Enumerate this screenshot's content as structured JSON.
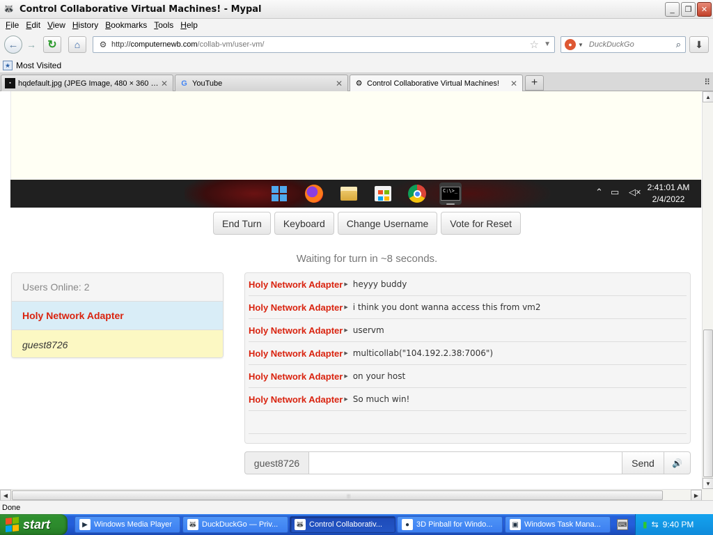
{
  "window": {
    "title": "Control Collaborative Virtual Machines! - Mypal",
    "minimize_glyph": "_",
    "maximize_glyph": "❐",
    "close_glyph": "✕"
  },
  "menu": {
    "items": [
      {
        "underline": "F",
        "rest": "ile"
      },
      {
        "underline": "E",
        "rest": "dit"
      },
      {
        "underline": "V",
        "rest": "iew"
      },
      {
        "underline": "H",
        "rest": "istory"
      },
      {
        "underline": "B",
        "rest": "ookmarks"
      },
      {
        "underline": "T",
        "rest": "ools"
      },
      {
        "underline": "H",
        "rest": "elp"
      }
    ]
  },
  "navbar": {
    "url_scheme": "http://",
    "url_host": "computernewb.com",
    "url_path": "/collab-vm/user-vm/",
    "search_placeholder": "DuckDuckGo"
  },
  "bookmarks": {
    "items": [
      "Most Visited"
    ]
  },
  "tabs": {
    "items": [
      {
        "label": "hqdefault.jpg (JPEG Image, 480 × 360 pi...",
        "icon": "image-thumb-icon",
        "active": false
      },
      {
        "label": "YouTube",
        "icon": "google-icon",
        "active": false
      },
      {
        "label": "Control Collaborative Virtual Machines!",
        "icon": "collabvm-icon",
        "active": true
      }
    ],
    "new_tab": "+"
  },
  "vm": {
    "clock_time": "2:41:01 AM",
    "clock_date": "2/4/2022",
    "taskbar_icons": [
      "windows-start-icon",
      "firefox-icon",
      "file-explorer-icon",
      "microsoft-store-icon",
      "chrome-icon",
      "terminal-icon"
    ],
    "terminal_text": "C:\\>_"
  },
  "controls": {
    "end_turn": "End Turn",
    "keyboard": "Keyboard",
    "change_username": "Change Username",
    "vote_reset": "Vote for Reset"
  },
  "status_message": "Waiting for turn in ~8 seconds.",
  "users": {
    "header": "Users Online: 2",
    "list": [
      {
        "name": "Holy Network Adapter",
        "role": "admin"
      },
      {
        "name": "guest8726",
        "role": "guest"
      }
    ]
  },
  "chat": {
    "messages": [
      {
        "user": "Holy Network Adapter",
        "text": "heyyy buddy"
      },
      {
        "user": "Holy Network Adapter",
        "text": "i think you dont wanna access this from vm2"
      },
      {
        "user": "Holy Network Adapter",
        "text": "uservm"
      },
      {
        "user": "Holy Network Adapter",
        "text": "multicollab(\"104.192.2.38:7006\")"
      },
      {
        "user": "Holy Network Adapter",
        "text": "on your host"
      },
      {
        "user": "Holy Network Adapter",
        "text": "So much win!"
      }
    ],
    "nick": "guest8726",
    "input_value": "",
    "send_label": "Send",
    "volume_glyph": "🔊"
  },
  "statusbar": {
    "text": "Done"
  },
  "xp_taskbar": {
    "start_label": "start",
    "tasks": [
      {
        "label": "Windows Media Player",
        "icon": "media-player-icon",
        "active": false
      },
      {
        "label": "DuckDuckGo — Priv...",
        "icon": "duckduckgo-icon",
        "active": false
      },
      {
        "label": "Control Collaborativ...",
        "icon": "collabvm-icon",
        "active": true
      },
      {
        "label": "3D Pinball for Windo...",
        "icon": "pinball-icon",
        "active": false
      },
      {
        "label": "Windows Task Mana...",
        "icon": "task-manager-icon",
        "active": false
      }
    ],
    "clock": "9:40 PM"
  },
  "colors": {
    "admin_name": "#d9230f",
    "admin_row_bg": "#d9edf7",
    "guest_row_bg": "#fcf8c3",
    "xp_blue": "#245edb",
    "xp_start_green": "#2e8f2e"
  }
}
